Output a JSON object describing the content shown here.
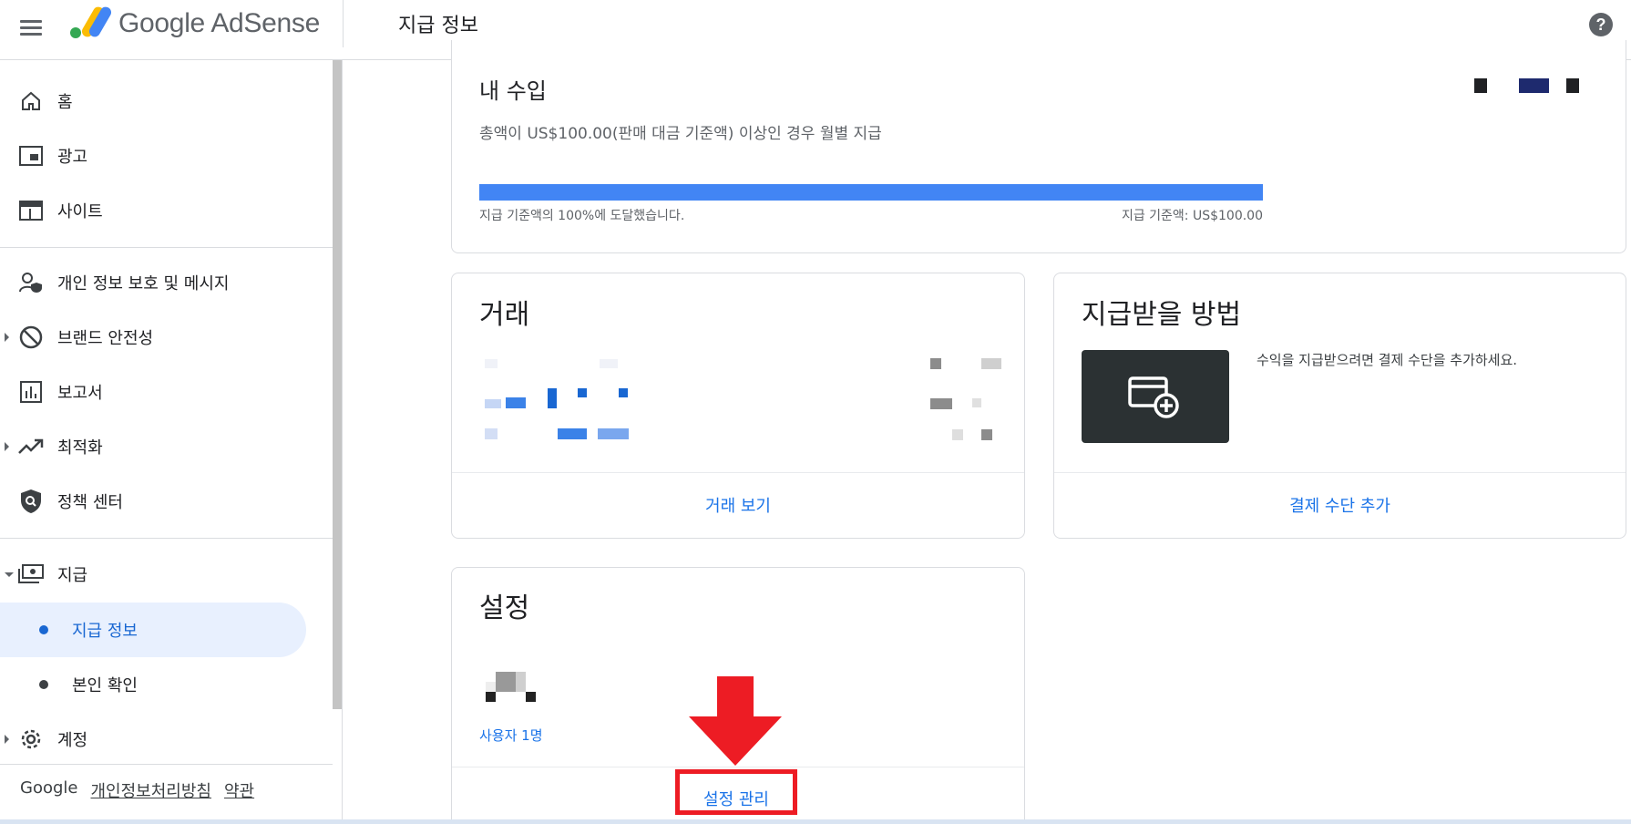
{
  "header": {
    "brand": "Google AdSense",
    "page_title": "지급 정보",
    "help_icon": "help-circle-icon"
  },
  "sidebar": {
    "items": [
      {
        "label": "홈",
        "icon": "home-icon"
      },
      {
        "label": "광고",
        "icon": "ads-icon"
      },
      {
        "label": "사이트",
        "icon": "sites-icon"
      },
      {
        "label": "개인 정보 보호 및 메시지",
        "icon": "privacy-messaging-icon"
      },
      {
        "label": "브랜드 안전성",
        "icon": "block-icon"
      },
      {
        "label": "보고서",
        "icon": "reports-icon"
      },
      {
        "label": "최적화",
        "icon": "trending-up-icon"
      },
      {
        "label": "정책 센터",
        "icon": "policy-shield-icon"
      },
      {
        "label": "지급",
        "icon": "payments-icon"
      },
      {
        "label": "계정",
        "icon": "gear-icon"
      }
    ],
    "sub_items": [
      {
        "label": "지급 정보",
        "active": true
      },
      {
        "label": "본인 확인",
        "active": false
      }
    ],
    "footer": {
      "google": "Google",
      "privacy": "개인정보처리방침",
      "terms": "약관"
    }
  },
  "earnings_card": {
    "title": "내 수입",
    "description": "총액이 US$100.00(판매 대금 기준액) 이상인 경우 월별 지급",
    "progress_percent": 100,
    "progress_text": "지급 기준액의 100%에 도달했습니다.",
    "threshold_text": "지급 기준액: US$100.00"
  },
  "transactions_card": {
    "title": "거래",
    "link": "거래 보기"
  },
  "payment_method_card": {
    "title": "지급받을 방법",
    "description": "수익을 지급받으려면 결제 수단을 추가하세요.",
    "link": "결제 수단 추가"
  },
  "settings_card": {
    "title": "설정",
    "users": "사용자 1명",
    "link": "설정 관리"
  },
  "colors": {
    "accent": "#1a73e8",
    "progress": "#4285f4",
    "annotation": "#ed1c24",
    "active_nav_bg": "#e8f0fe"
  }
}
